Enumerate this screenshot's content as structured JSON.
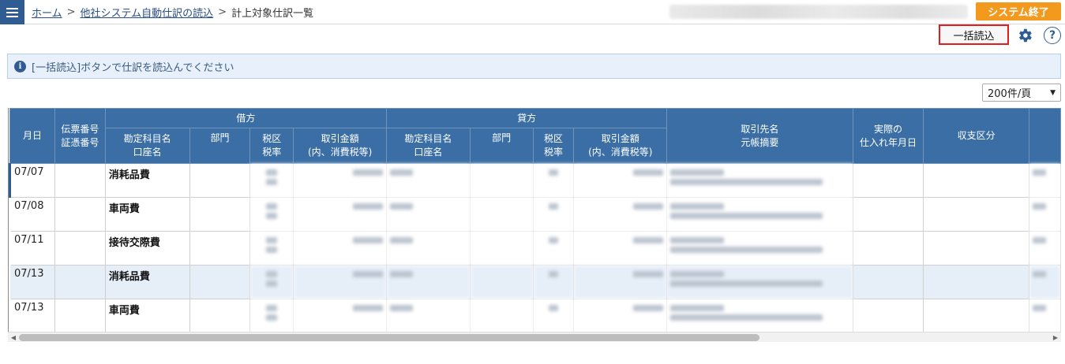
{
  "header": {
    "breadcrumb": [
      "ホーム",
      "他社システム自動仕訳の読込",
      "計上対象仕訳一覧"
    ],
    "separator": ">",
    "end_button": "システム終了"
  },
  "toolbar": {
    "bulk_import": "一括読込",
    "help_glyph": "?"
  },
  "info_message": {
    "icon": "i",
    "text": "[一括読込]ボタンで仕訳を読込んでください"
  },
  "per_page": {
    "selected": "200件/頁"
  },
  "table": {
    "group_headers": {
      "debit": "借方",
      "credit": "貸方"
    },
    "columns": {
      "date": "月日",
      "slip_l1": "伝票番号",
      "slip_l2": "証憑番号",
      "account_l1": "勘定科目名",
      "account_l2": "口座名",
      "dept": "部門",
      "tax_l1": "税区",
      "tax_l2": "税率",
      "amount_l1": "取引金額",
      "amount_l2": "(内、消費税等)",
      "partner_l1": "取引先名",
      "partner_l2": "元帳摘要",
      "actual_l1": "実際の",
      "actual_l2": "仕入れ年月日",
      "income": "収支区分"
    },
    "rows": [
      {
        "date": "07/07",
        "account": "消耗品費"
      },
      {
        "date": "07/08",
        "account": "車両費"
      },
      {
        "date": "07/11",
        "account": "接待交際費"
      },
      {
        "date": "07/13",
        "account": "消耗品費"
      },
      {
        "date": "07/13",
        "account": "車両費"
      }
    ]
  },
  "colors": {
    "header_bg": "#3a6ea5",
    "nav_btn": "#2f5d93",
    "end_button": "#f39a1e",
    "highlight": "#e21d1d"
  },
  "icons": {
    "menu": "hamburger-icon",
    "settings": "gear-icon",
    "help": "help-icon",
    "info": "info-icon"
  }
}
